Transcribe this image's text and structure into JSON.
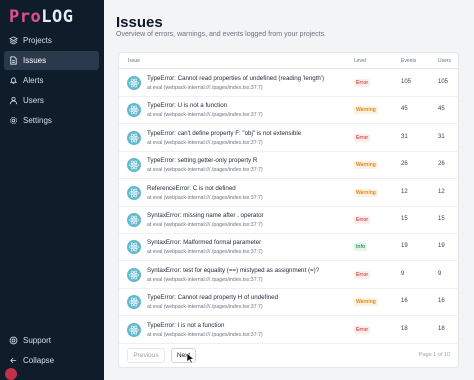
{
  "app": {
    "logo_part1": "Pro",
    "logo_part2": "LOG"
  },
  "sidebar": {
    "items": [
      {
        "label": "Projects",
        "icon": "layers-icon",
        "active": false
      },
      {
        "label": "Issues",
        "icon": "file-icon",
        "active": true
      },
      {
        "label": "Alerts",
        "icon": "bell-icon",
        "active": false
      },
      {
        "label": "Users",
        "icon": "users-icon",
        "active": false
      },
      {
        "label": "Settings",
        "icon": "gear-icon",
        "active": false
      }
    ],
    "bottom_items": [
      {
        "label": "Support",
        "icon": "support-icon"
      },
      {
        "label": "Collapse",
        "icon": "arrow-left-icon"
      }
    ]
  },
  "page": {
    "title": "Issues",
    "subtitle": "Overview of errors, warnings, and events logged from your projects."
  },
  "table": {
    "columns": [
      "Issue",
      "Level",
      "Events",
      "Users"
    ],
    "rows": [
      {
        "message": "TypeError: Cannot read properties of undefined (reading 'length')",
        "location": "at eval (webpack-internal:///./pages/index.tsx:37:7)",
        "level": "Error",
        "events": "105",
        "users": "105"
      },
      {
        "message": "TypeError: U is not a function",
        "location": "at eval (webpack-internal:///./pages/index.tsx:37:7)",
        "level": "Warning",
        "events": "45",
        "users": "45"
      },
      {
        "message": "TypeError: can't define property F: \"obj\" is not extensible",
        "location": "at eval (webpack-internal:///./pages/index.tsx:37:7)",
        "level": "Error",
        "events": "31",
        "users": "31"
      },
      {
        "message": "TypeError: setting getter-only property R",
        "location": "at eval (webpack-internal:///./pages/index.tsx:37:7)",
        "level": "Warning",
        "events": "26",
        "users": "26"
      },
      {
        "message": "ReferenceError: C is not defined",
        "location": "at eval (webpack-internal:///./pages/index.tsx:37:7)",
        "level": "Warning",
        "events": "12",
        "users": "12"
      },
      {
        "message": "SyntaxError: missing name after . operator",
        "location": "at eval (webpack-internal:///./pages/index.tsx:37:7)",
        "level": "Error",
        "events": "15",
        "users": "15"
      },
      {
        "message": "SyntaxError: Malformed formal parameter",
        "location": "at eval (webpack-internal:///./pages/index.tsx:37:7)",
        "level": "Info",
        "events": "19",
        "users": "19"
      },
      {
        "message": "SyntaxError: test for equality (==) mistyped as assignment (=)?",
        "location": "at eval (webpack-internal:///./pages/index.tsx:37:7)",
        "level": "Error",
        "events": "9",
        "users": "9"
      },
      {
        "message": "TypeError: Cannot read property H of undefined",
        "location": "at eval (webpack-internal:///./pages/index.tsx:37:7)",
        "level": "Warning",
        "events": "16",
        "users": "16"
      },
      {
        "message": "TypeError: I is not a function",
        "location": "at eval (webpack-internal:///./pages/index.tsx:37:7)",
        "level": "Error",
        "events": "18",
        "users": "18"
      }
    ]
  },
  "pagination": {
    "previous_label": "Previous",
    "next_label": "Next",
    "page_info": "Page 1 of 10"
  },
  "colors": {
    "sidebar_bg": "#0f1d2b",
    "error": "#d9534f",
    "warning": "#e08a1e",
    "info": "#2f9e5b"
  }
}
